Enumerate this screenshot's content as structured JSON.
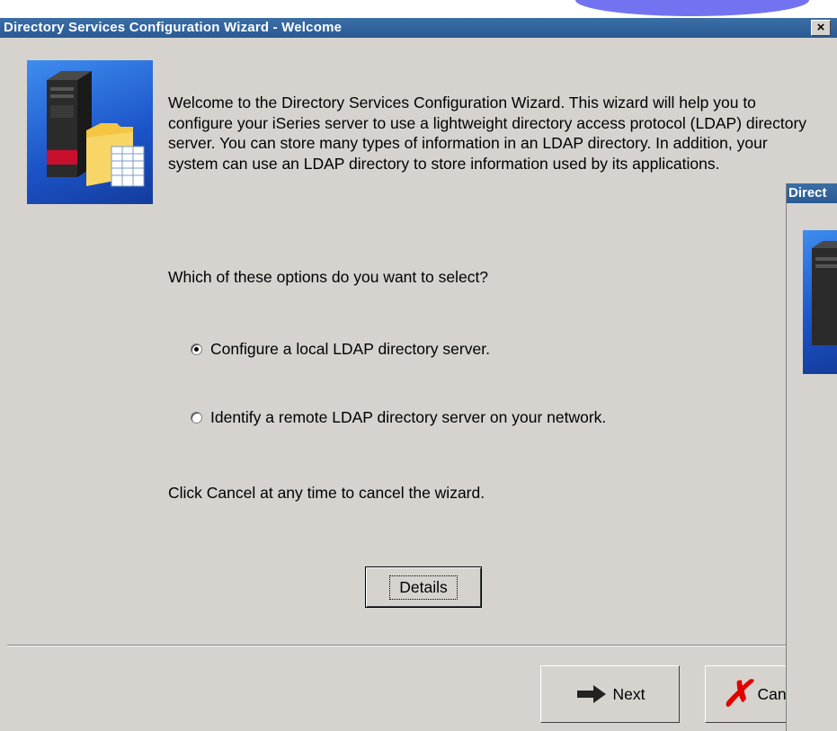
{
  "window": {
    "title": "Directory Services Configuration Wizard - Welcome",
    "close_label": "×"
  },
  "content": {
    "welcome_text": "Welcome to the Directory Services Configuration Wizard. This wizard will help you to configure your iSeries server to use a lightweight directory access protocol (LDAP) directory server. You can store many types of information in an LDAP directory. In addition, your system can use an LDAP directory to store information used by its applications.",
    "question": "Which of these options do you want to select?",
    "options": [
      {
        "label": "Configure a local LDAP directory server.",
        "selected": true
      },
      {
        "label": "Identify a remote LDAP directory server on your network.",
        "selected": false
      }
    ],
    "cancel_hint": "Click Cancel at any time to cancel the wizard.",
    "details_label": "Details"
  },
  "buttons": {
    "next_label": "Next",
    "cancel_label": "Can"
  },
  "second_window": {
    "title": "Direct"
  },
  "icons": {
    "wizard": "server-folder-icon",
    "next": "arrow-right-icon",
    "cancel": "red-x-icon",
    "close": "close-icon"
  },
  "colors": {
    "titlebar": "#2a5a94",
    "background": "#d6d3ce",
    "cancel_x": "#e00000"
  }
}
